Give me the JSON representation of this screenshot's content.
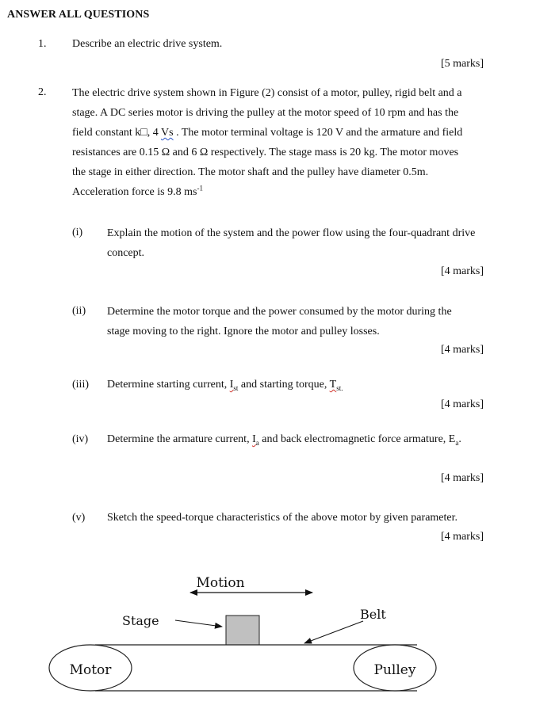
{
  "heading": "ANSWER ALL QUESTIONS",
  "questions": {
    "q1": {
      "number": "1.",
      "text": "Describe an electric drive system.",
      "marks": "[5 marks]"
    },
    "q2": {
      "number": "2.",
      "lines": {
        "l1": "The electric drive system shown in Figure (2) consist of a motor, pulley, rigid belt and a",
        "l2": "stage. A DC series motor is driving the pulley at the motor speed of 10 rpm and has the",
        "l3_a": "field constant k□, 4 ",
        "l3_b": "Vs",
        "l3_c": " . The motor terminal voltage is 120 V and the armature and field",
        "l4": "resistances are 0.15 Ω and 6 Ω respectively. The stage mass is 20 kg. The motor moves",
        "l5": "the stage in either direction. The motor shaft and the pulley have diameter 0.5m.",
        "l6_a": "Acceleration force is 9.8 ms",
        "l6_sup": "-1"
      },
      "parts": {
        "i": {
          "label": "(i)",
          "line1": "Explain the motion of the system and the power flow using the four-quadrant drive",
          "line2": "concept.",
          "marks": "[4 marks]"
        },
        "ii": {
          "label": "(ii)",
          "line1": "Determine the motor torque and the power consumed by the motor during the",
          "line2": "stage moving to the right. Ignore the motor and pulley losses.",
          "marks": "[4 marks]"
        },
        "iii": {
          "label": "(iii)",
          "text_a": "Determine starting current, ",
          "I": "I",
          "I_sub": "st",
          "text_b": " and starting torque, ",
          "T": "T",
          "T_sub": "st.",
          "marks": "[4 marks]"
        },
        "iv": {
          "label": "(iv)",
          "text_a": "Determine the armature current, ",
          "I": "I",
          "I_sub": "a",
          "text_b": " and back electromagnetic force armature, E",
          "E_sub": "a",
          "text_c": ".",
          "marks": "[4 marks]"
        },
        "v": {
          "label": "(v)",
          "text": "Sketch the speed-torque characteristics of the above motor by given parameter.",
          "marks": "[4 marks]"
        }
      }
    }
  },
  "figure": {
    "motion_label": "Motion",
    "stage_label": "Stage",
    "belt_label": "Belt",
    "motor_label": "Motor",
    "pulley_label": "Pulley",
    "stage_fill": "#c0c0c0"
  }
}
